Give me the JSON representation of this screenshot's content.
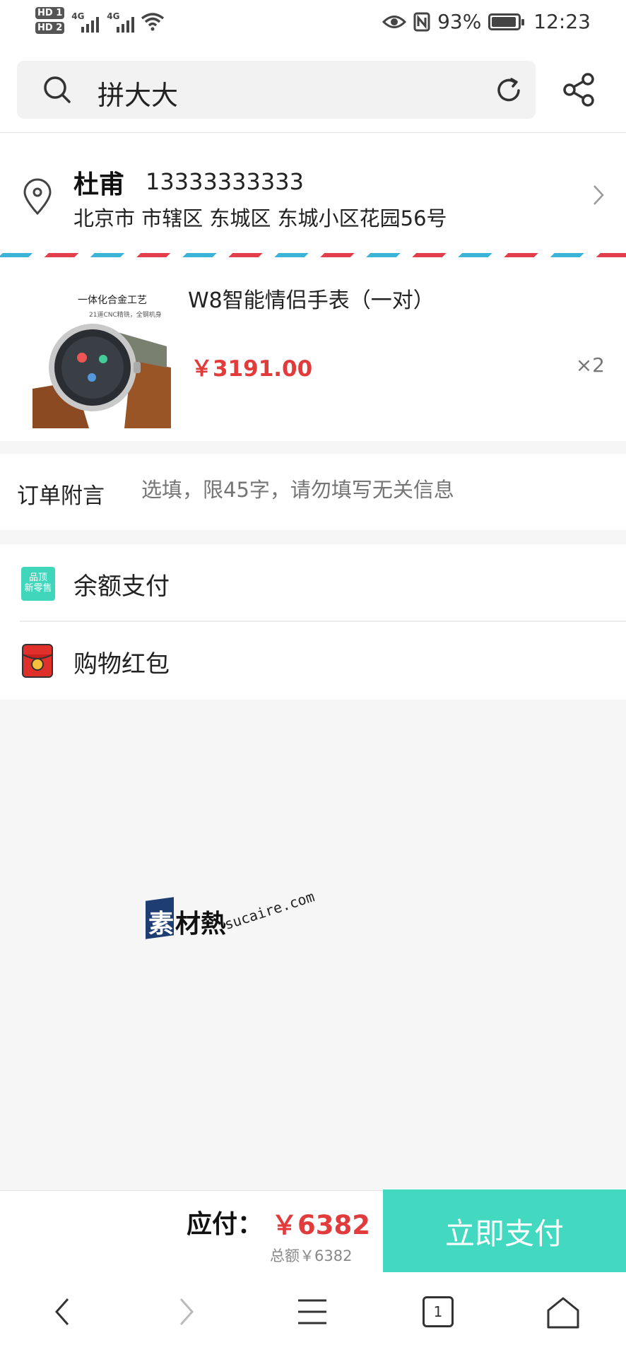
{
  "status_bar": {
    "sim1": "HD 1",
    "sim2": "HD 2",
    "net1": "4G",
    "net2": "4G",
    "battery": "93%",
    "time": "12:23"
  },
  "top_bar": {
    "search_text": "拼大大"
  },
  "address": {
    "name": "杜甫",
    "phone": "13333333333",
    "detail": "北京市 市辖区 东城区 东城小区花园56号"
  },
  "product": {
    "image_caption": "一体化合金工艺",
    "image_subcaption": "21道CNC精铣，全钢机身",
    "title": "W8智能情侣手表（一对）",
    "price": "￥3191.00",
    "quantity": "×2"
  },
  "note": {
    "label": "订单附言",
    "placeholder": "选填，限45字，请勿填写无关信息"
  },
  "payment_options": [
    {
      "label": "余额支付",
      "icon_text": "品顶\n新零售",
      "icon": "brand-logo-icon"
    },
    {
      "label": "购物红包",
      "icon": "red-envelope-icon"
    }
  ],
  "watermark": {
    "cn_first": "素",
    "cn_rest": "材熱",
    "en": "sucaire.com"
  },
  "footer": {
    "due_label": "应付：",
    "due_amount": "￥6382",
    "total_text": "总额￥6382",
    "pay_button": "立即支付"
  },
  "navbar": {
    "tab_count": "1"
  },
  "colors": {
    "accent": "#43d9c1",
    "price_red": "#e23b3b",
    "stripe_red": "#e33e4c",
    "stripe_blue": "#3cb4d8"
  }
}
